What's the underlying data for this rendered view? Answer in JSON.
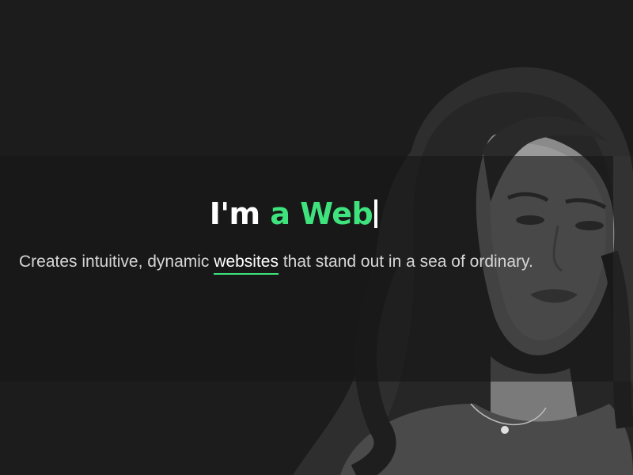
{
  "hero": {
    "heading_prefix": "I'm",
    "heading_accent": "a Web",
    "tagline_before": "Creates intuitive, dynamic",
    "tagline_highlight": "websites",
    "tagline_after": "that stand out in a sea of ordinary."
  },
  "colors": {
    "background": "#1c1c1c",
    "accent": "#3fe37d",
    "text": "#d6d6d6",
    "heading": "#ffffff"
  },
  "icons": {
    "portrait": "person-portrait-image",
    "caret": "typing-caret"
  }
}
